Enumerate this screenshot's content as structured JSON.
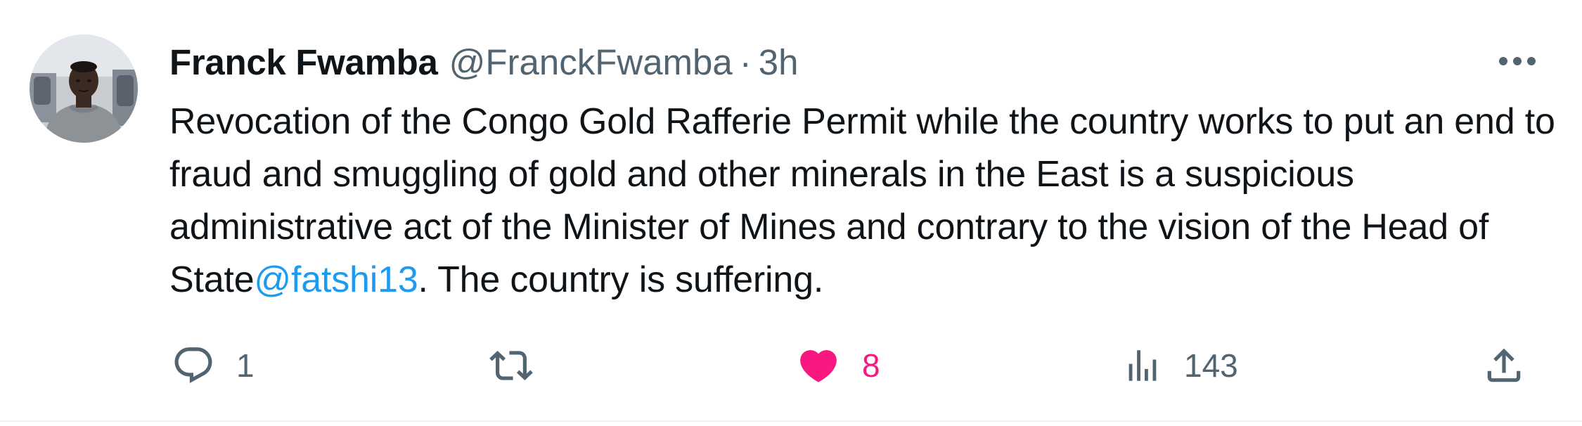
{
  "tweet": {
    "author": {
      "display_name": "Franck Fwamba",
      "handle": "@FranckFwamba",
      "separator": "·",
      "time": "3h"
    },
    "text": {
      "before_mention": "Revocation of the Congo Gold Rafferie Permit while the country works to put an end to fraud and smuggling of gold and other minerals in the East is a suspicious administrative act of the Minister of Mines and contrary to the vision of the Head of State",
      "mention": "@fatshi13",
      "after_mention": ". The country is suffering."
    },
    "actions": {
      "reply": {
        "icon": "reply-icon",
        "count": "1"
      },
      "retweet": {
        "icon": "retweet-icon",
        "count": ""
      },
      "like": {
        "icon": "heart-filled-icon",
        "count": "8",
        "liked": true
      },
      "views": {
        "icon": "views-icon",
        "count": "143"
      },
      "share": {
        "icon": "share-icon"
      }
    },
    "more": {
      "icon": "more-horizontal-icon"
    }
  },
  "colors": {
    "text_primary": "#0f1419",
    "text_secondary": "#536471",
    "link": "#1d9bf0",
    "like": "#f91880",
    "divider": "#eff3f4"
  }
}
